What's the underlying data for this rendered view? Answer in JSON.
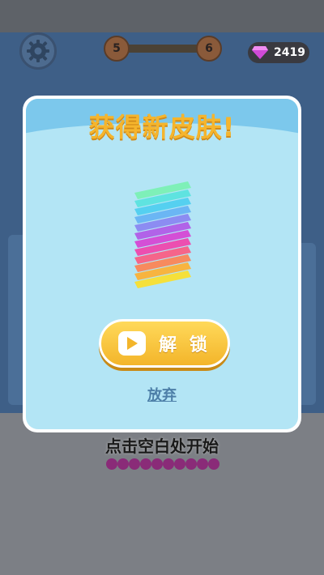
{
  "hud": {
    "level_current": "5",
    "level_next": "6",
    "gems": "2419"
  },
  "dialog": {
    "title": "获得新皮肤!",
    "unlock_label": "解 锁",
    "giveup_label": "放弃"
  },
  "hint": "点击空白处开始",
  "colors": {
    "title": "#f5b52d",
    "button": "#f3b52a",
    "dialog_bg": "#b3e5f5",
    "header_bg": "#7cc8ec",
    "link": "#4d7fa8"
  }
}
